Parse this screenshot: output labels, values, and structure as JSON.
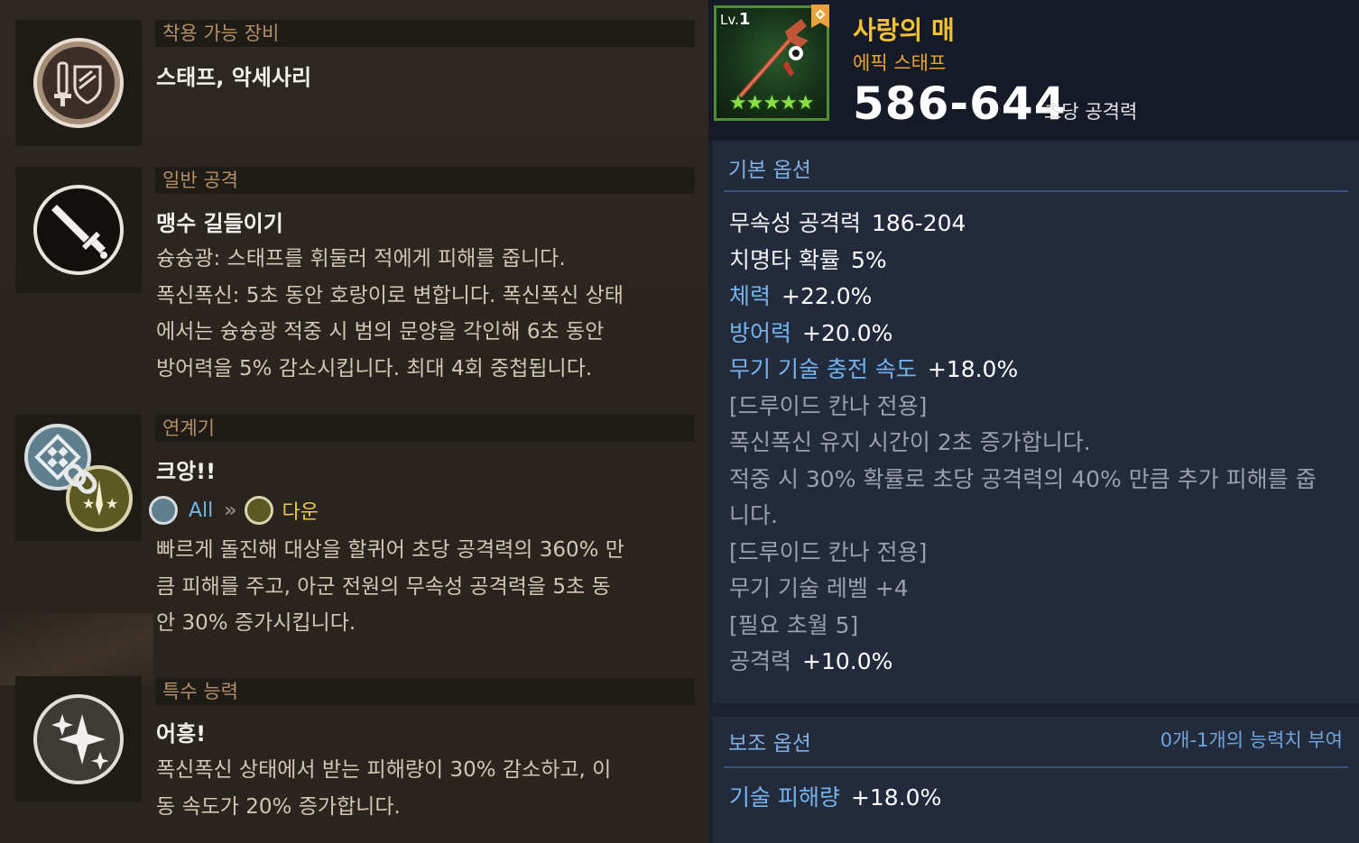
{
  "left": {
    "sections": [
      {
        "header": "착용 가능 장비",
        "title": "스태프, 악세사리"
      },
      {
        "header": "일반 공격",
        "title": "맹수 길들이기",
        "desc_lines": [
          "슝슝광: 스태프를 휘둘러 적에게 피해를 줍니다.",
          "폭신폭신: 5초 동안 호랑이로 변합니다. 폭신폭신 상태",
          "에서는 슝슝광 적중 시 범의 문양을 각인해 6초 동안",
          "방어력을 5% 감소시킵니다. 최대 4회 중첩됩니다."
        ]
      },
      {
        "header": "연계기",
        "title": "크앙!!",
        "combo_from": "All",
        "combo_arrow": "»",
        "combo_to": "다운",
        "desc_lines": [
          "빠르게 돌진해 대상을 할퀴어 초당 공격력의 360% 만",
          "큼 피해를 주고, 아군 전원의 무속성 공격력을 5초 동",
          "안 30% 증가시킵니다."
        ]
      },
      {
        "header": "특수 능력",
        "title": "어흥!",
        "desc_lines": [
          "폭신폭신 상태에서 받는 피해량이 30% 감소하고, 이",
          "동 속도가 20% 증가합니다."
        ]
      }
    ]
  },
  "item": {
    "level_prefix": "Lv.",
    "level": "1",
    "stars": "★★★★★",
    "name": "사랑의 매",
    "type": "에픽 스태프",
    "attack": "586-644",
    "attack_label": "초당 공격력"
  },
  "basic_options": {
    "header": "기본 옵션",
    "lines": [
      {
        "k": "무속성 공격력",
        "v": "186-204",
        "color": "white"
      },
      {
        "k": "치명타 확률",
        "v": "5%",
        "color": "white"
      },
      {
        "k": "체력",
        "v": "+22.0%",
        "color": "blue"
      },
      {
        "k": "방어력",
        "v": "+20.0%",
        "color": "blue"
      },
      {
        "k": "무기 기술 충전 속도",
        "v": "+18.0%",
        "color": "blue"
      },
      {
        "k": "[드루이드 칸나 전용]",
        "v": "",
        "color": "gray"
      },
      {
        "k": "폭신폭신 유지 시간이 2초 증가합니다.",
        "v": "",
        "color": "gray"
      },
      {
        "k": "적중 시 30% 확률로 초당 공격력의 40% 만큼 추가 피해를 줍",
        "v": "",
        "color": "gray"
      },
      {
        "k": "니다.",
        "v": "",
        "color": "gray"
      },
      {
        "k": "[드루이드 칸나 전용]",
        "v": "",
        "color": "gray"
      },
      {
        "k": "무기 기술 레벨 +4",
        "v": "",
        "color": "gray"
      },
      {
        "k": "[필요 초월 5]",
        "v": "",
        "color": "gray"
      },
      {
        "k": "공격력",
        "v": "+10.0%",
        "color": "gray",
        "v_color": "green"
      }
    ]
  },
  "sub_options": {
    "header": "보조 옵션",
    "note": "0개-1개의 능력치 부여",
    "lines": [
      {
        "k": "기술 피해량",
        "v": "+18.0%",
        "color": "blue"
      }
    ]
  },
  "colors": {
    "left_bg": "#2a251f",
    "right_bg": "#1b2130",
    "accent_gold": "#f2c230",
    "accent_blue": "#74b4ee",
    "accent_green": "#4fe04a"
  }
}
